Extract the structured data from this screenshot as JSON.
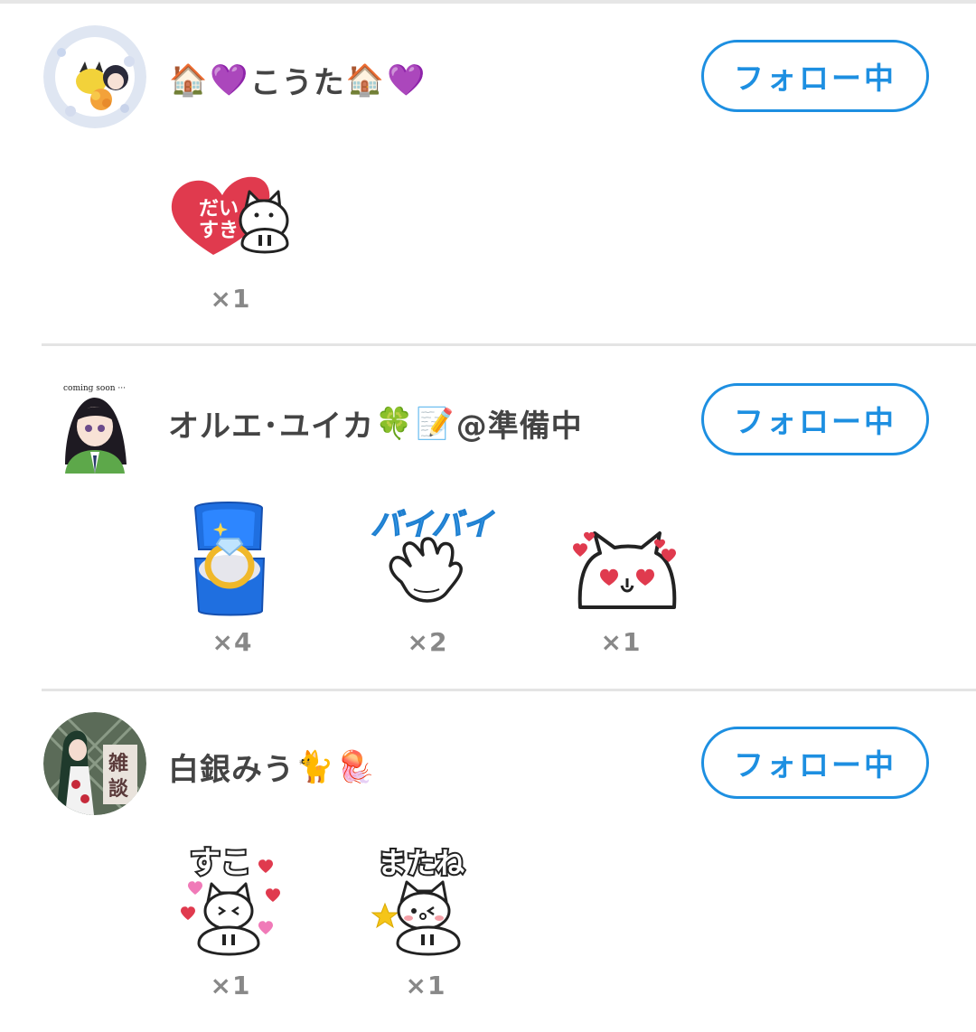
{
  "follow_label": "フォロー中",
  "users": [
    {
      "name_parts": [
        "🏠",
        "💜",
        "こうた",
        "🏠",
        "💜"
      ],
      "stickers": [
        {
          "icon": "daisuki-heart-cat-sticker",
          "count": "×1"
        }
      ]
    },
    {
      "name_parts": [
        "オルエ･ユイカ",
        "🍀",
        "📝",
        "@準備中"
      ],
      "avatar_caption": "coming soon ···",
      "stickers": [
        {
          "icon": "ring-box-sticker",
          "count": "×4"
        },
        {
          "icon": "byebye-hand-sticker",
          "label": "バイバイ",
          "count": "×2"
        },
        {
          "icon": "heart-eyes-cat-sticker",
          "count": "×1"
        }
      ]
    },
    {
      "name_parts": [
        "白銀みう",
        "🐈",
        "🪼"
      ],
      "stickers": [
        {
          "icon": "suko-heart-cat-sticker",
          "label": "すこ",
          "count": "×1"
        },
        {
          "icon": "matane-star-cat-sticker",
          "label": "またね",
          "count": "×1"
        }
      ]
    }
  ],
  "colors": {
    "accent": "#1d8fe1",
    "heart": "#e03a4e",
    "ring_box": "#1f6fe0"
  }
}
